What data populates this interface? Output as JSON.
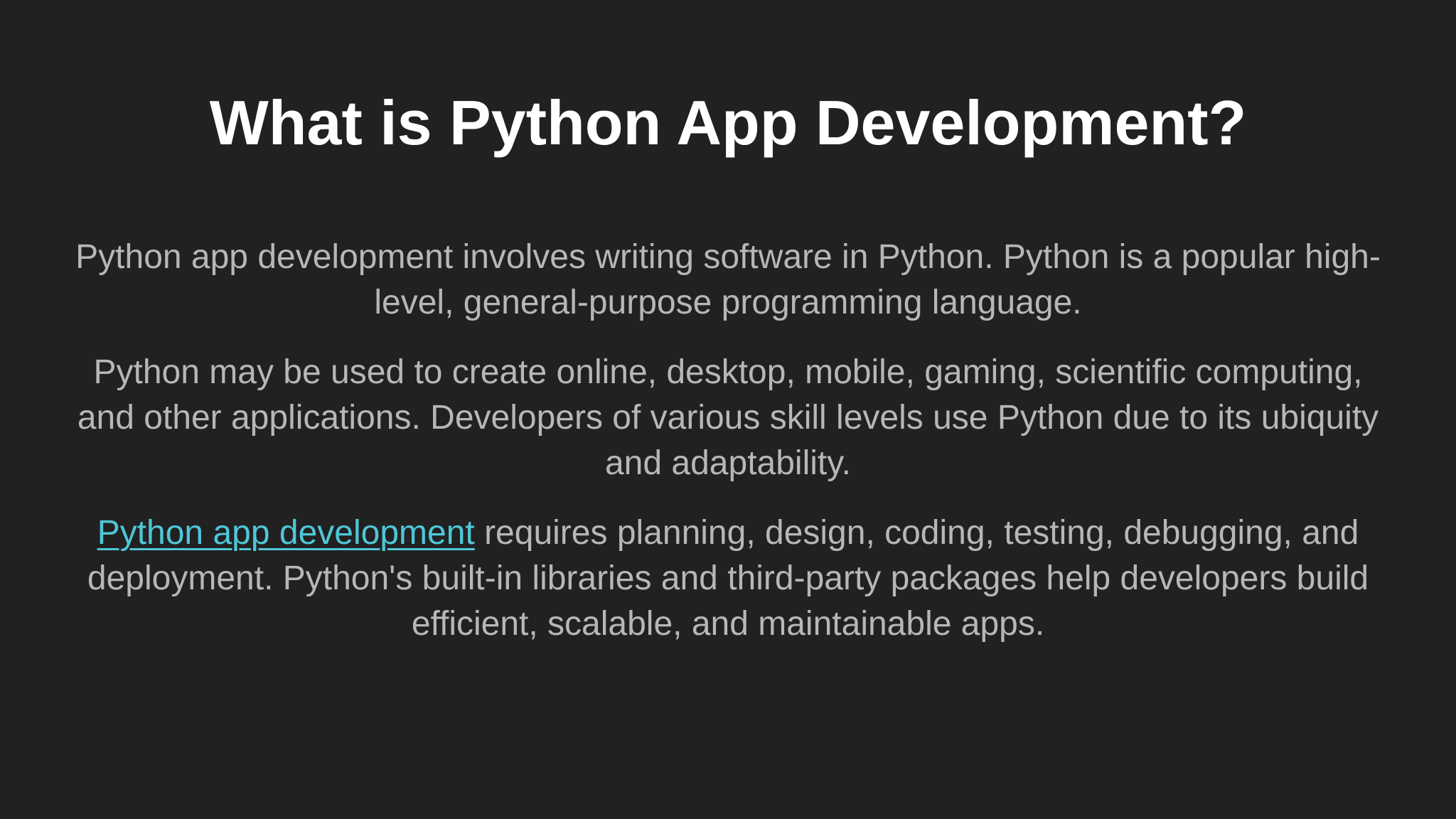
{
  "slide": {
    "title": "What is Python App Development?",
    "paragraphs": [
      {
        "text": "Python app development involves writing software in Python. Python is a popular high-level, general-purpose programming language."
      },
      {
        "text": "Python may be used to create online, desktop, mobile, gaming, scientific computing, and other applications. Developers of various skill levels use Python due to its ubiquity and adaptability."
      },
      {
        "link_text": "Python app development",
        "text": " requires planning, design, coding, testing, debugging, and deployment. Python's built-in libraries and third-party packages help developers build efficient, scalable, and maintainable apps."
      }
    ]
  },
  "colors": {
    "background": "#212121",
    "title": "#ffffff",
    "body": "#b7b7b7",
    "link": "#4fc7d8"
  }
}
